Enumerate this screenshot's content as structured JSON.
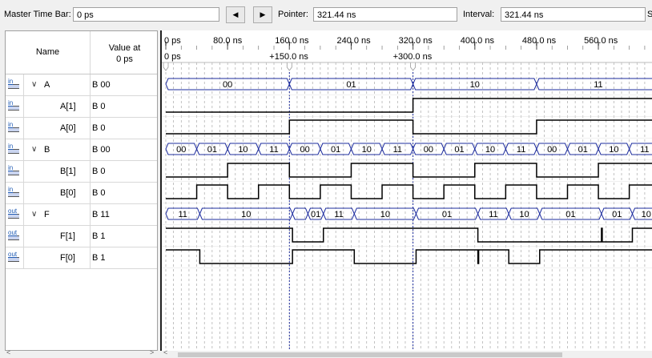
{
  "toolbar": {
    "master_label": "Master Time Bar:",
    "master_value": "0 ps",
    "prev_icon": "triangle-left-icon",
    "next_icon": "triangle-right-icon",
    "pointer_label": "Pointer:",
    "pointer_value": "321.44 ns",
    "interval_label": "Interval:",
    "interval_value": "321.44 ns",
    "start_label": "S"
  },
  "header": {
    "name": "Name",
    "value_line1": "Value at",
    "value_line2": "0 ps"
  },
  "signals": [
    {
      "name": "A",
      "value": "B 00",
      "dir": "in",
      "bus": true
    },
    {
      "name": "A[1]",
      "value": "B 0",
      "dir": "in",
      "bus": false
    },
    {
      "name": "A[0]",
      "value": "B 0",
      "dir": "in",
      "bus": false
    },
    {
      "name": "B",
      "value": "B 00",
      "dir": "in",
      "bus": true
    },
    {
      "name": "B[1]",
      "value": "B 0",
      "dir": "in",
      "bus": false
    },
    {
      "name": "B[0]",
      "value": "B 0",
      "dir": "in",
      "bus": false
    },
    {
      "name": "F",
      "value": "B 11",
      "dir": "out",
      "bus": true
    },
    {
      "name": "F[1]",
      "value": "B 1",
      "dir": "out",
      "bus": false
    },
    {
      "name": "F[0]",
      "value": "B 1",
      "dir": "out",
      "bus": false
    }
  ],
  "pin_labels": {
    "in": "in",
    "out": "out"
  },
  "timeline": {
    "ticks": [
      "0 ps",
      "80.0 ns",
      "160.0 ns",
      "240.0 ns",
      "320.0 ns",
      "400.0 ns",
      "480.0 ns",
      "560.0 ns"
    ],
    "tick_times": [
      0,
      80,
      160,
      240,
      320,
      400,
      480,
      560
    ],
    "markers": [
      {
        "label": "0 ps",
        "t": 0
      },
      {
        "label": "+150.0 ns",
        "t": 160
      },
      {
        "label": "+300.0 ns",
        "t": 320
      }
    ]
  },
  "waves": {
    "A": [
      {
        "t0": 0,
        "t1": 160,
        "v": "00"
      },
      {
        "t0": 160,
        "t1": 320,
        "v": "01"
      },
      {
        "t0": 320,
        "t1": 480,
        "v": "10"
      },
      {
        "t0": 480,
        "t1": 640,
        "v": "11"
      }
    ],
    "A1": [
      [
        0,
        0
      ],
      [
        320,
        1
      ]
    ],
    "A0": [
      [
        0,
        0
      ],
      [
        160,
        1
      ],
      [
        320,
        0
      ],
      [
        480,
        1
      ]
    ],
    "B": [
      {
        "t0": 0,
        "t1": 40,
        "v": "00"
      },
      {
        "t0": 40,
        "t1": 80,
        "v": "01"
      },
      {
        "t0": 80,
        "t1": 120,
        "v": "10"
      },
      {
        "t0": 120,
        "t1": 160,
        "v": "11"
      },
      {
        "t0": 160,
        "t1": 200,
        "v": "00"
      },
      {
        "t0": 200,
        "t1": 240,
        "v": "01"
      },
      {
        "t0": 240,
        "t1": 280,
        "v": "10"
      },
      {
        "t0": 280,
        "t1": 320,
        "v": "11"
      },
      {
        "t0": 320,
        "t1": 360,
        "v": "00"
      },
      {
        "t0": 360,
        "t1": 400,
        "v": "01"
      },
      {
        "t0": 400,
        "t1": 440,
        "v": "10"
      },
      {
        "t0": 440,
        "t1": 480,
        "v": "11"
      },
      {
        "t0": 480,
        "t1": 520,
        "v": "00"
      },
      {
        "t0": 520,
        "t1": 560,
        "v": "01"
      },
      {
        "t0": 560,
        "t1": 600,
        "v": "10"
      },
      {
        "t0": 600,
        "t1": 640,
        "v": "11"
      }
    ],
    "B1": [
      [
        0,
        0
      ],
      [
        80,
        1
      ],
      [
        160,
        0
      ],
      [
        240,
        1
      ],
      [
        320,
        0
      ],
      [
        400,
        1
      ],
      [
        480,
        0
      ],
      [
        560,
        1
      ]
    ],
    "B0": [
      [
        0,
        0
      ],
      [
        40,
        1
      ],
      [
        80,
        0
      ],
      [
        120,
        1
      ],
      [
        160,
        0
      ],
      [
        200,
        1
      ],
      [
        240,
        0
      ],
      [
        280,
        1
      ],
      [
        320,
        0
      ],
      [
        360,
        1
      ],
      [
        400,
        0
      ],
      [
        440,
        1
      ],
      [
        480,
        0
      ],
      [
        520,
        1
      ],
      [
        560,
        0
      ],
      [
        600,
        1
      ]
    ],
    "F": [
      {
        "t0": 0,
        "t1": 44,
        "v": "11"
      },
      {
        "t0": 44,
        "t1": 164,
        "v": "10"
      },
      {
        "t0": 164,
        "t1": 184,
        "v": ""
      },
      {
        "t0": 184,
        "t1": 204,
        "v": "01"
      },
      {
        "t0": 204,
        "t1": 244,
        "v": "11"
      },
      {
        "t0": 244,
        "t1": 324,
        "v": "10"
      },
      {
        "t0": 324,
        "t1": 404,
        "v": "01"
      },
      {
        "t0": 404,
        "t1": 444,
        "v": "11"
      },
      {
        "t0": 444,
        "t1": 484,
        "v": "10"
      },
      {
        "t0": 484,
        "t1": 564,
        "v": "01"
      },
      {
        "t0": 564,
        "t1": 604,
        "v": "01"
      },
      {
        "t0": 604,
        "t1": 640,
        "v": "10"
      }
    ],
    "F1": [
      [
        0,
        1
      ],
      [
        164,
        0
      ],
      [
        204,
        1
      ],
      [
        404,
        0
      ],
      [
        564,
        1
      ],
      [
        565,
        0
      ],
      [
        604,
        1
      ]
    ],
    "F0": [
      [
        0,
        1
      ],
      [
        44,
        0
      ],
      [
        164,
        1
      ],
      [
        244,
        0
      ],
      [
        324,
        1
      ],
      [
        404,
        0
      ],
      [
        405,
        1
      ],
      [
        444,
        0
      ],
      [
        484,
        1
      ]
    ]
  },
  "colors": {
    "bus": "#1d2c9e",
    "wave": "#000000",
    "grid": "#a9a9a9",
    "cursor": "#1d2c9e"
  }
}
